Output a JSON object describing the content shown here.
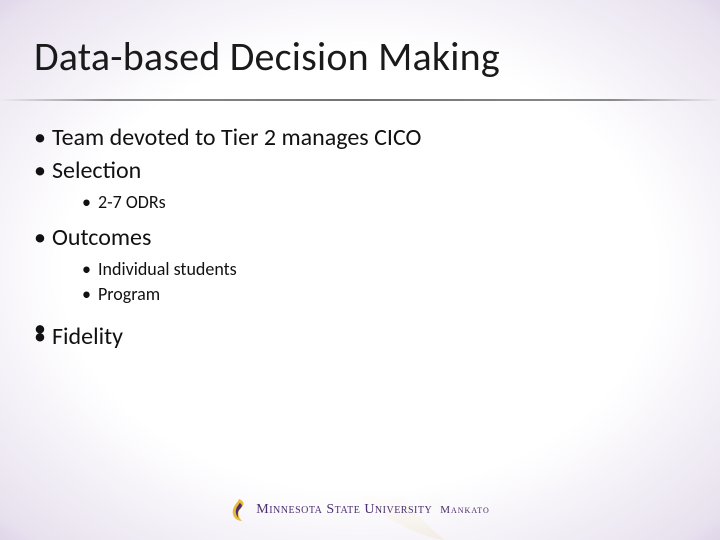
{
  "title": "Data-based Decision Making",
  "bullets": {
    "b0": "Team devoted to Tier 2 manages CICO",
    "b1": "Selection",
    "b1_0": "2-7 ODRs",
    "b2": "Outcomes",
    "b2_0": "Individual students",
    "b2_1": "Program",
    "b3": "Fidelity"
  },
  "footer": {
    "org_main": "Minnesota State University",
    "org_sub": "Mankato"
  }
}
